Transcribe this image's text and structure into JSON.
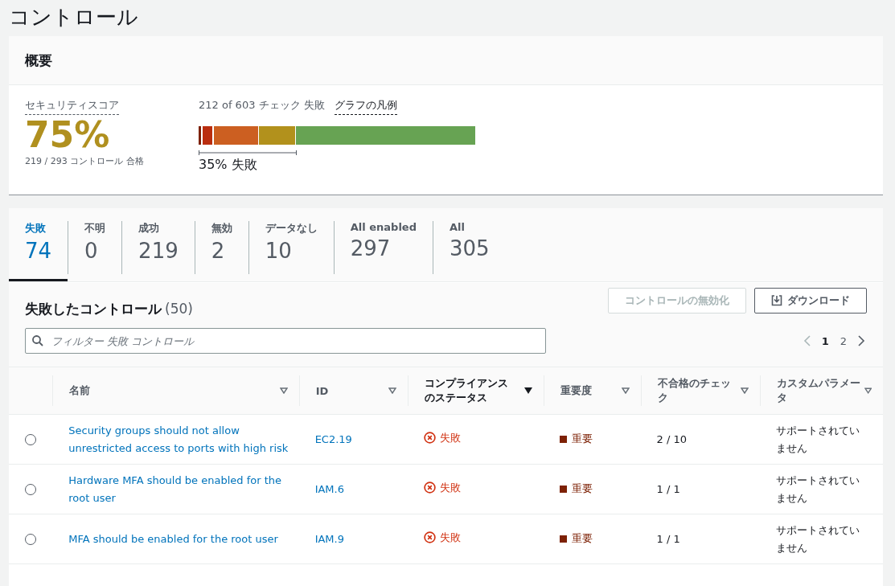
{
  "page_title": "コントロール",
  "overview": {
    "title": "概要",
    "score_label": "セキュリティスコア",
    "score": "75%",
    "score_detail": "219 / 293 コントロール 合格",
    "checks_summary": "212 of 603 チェック 失敗",
    "legend_link": "グラフの凡例",
    "failed_share": "35% 失敗"
  },
  "tabs": [
    {
      "label": "失敗",
      "count": "74",
      "selected": true
    },
    {
      "label": "不明",
      "count": "0",
      "selected": false
    },
    {
      "label": "成功",
      "count": "219",
      "selected": false
    },
    {
      "label": "無効",
      "count": "2",
      "selected": false
    },
    {
      "label": "データなし",
      "count": "10",
      "selected": false
    },
    {
      "label": "All enabled",
      "count": "297",
      "selected": false
    },
    {
      "label": "All",
      "count": "305",
      "selected": false
    }
  ],
  "table_panel": {
    "title": "失敗したコントロール",
    "count": "(50)",
    "buttons": [
      {
        "label": "コントロールの無効化",
        "kind": "plain",
        "disabled": true
      },
      {
        "label": "ダウンロード",
        "kind": "download",
        "disabled": false
      }
    ],
    "filter": {
      "placeholder": "フィルター 失敗 コントロール"
    },
    "pagination": [
      {
        "label": "1",
        "selected": true
      },
      {
        "label": "2",
        "selected": false
      }
    ]
  },
  "table": {
    "columns": [
      {
        "label": "名前",
        "sorted": false
      },
      {
        "label": "ID",
        "sorted": false
      },
      {
        "label": "コンプライアンスのステータス",
        "sorted": true
      },
      {
        "label": "重要度",
        "sorted": false
      },
      {
        "label": "不合格のチェック",
        "sorted": false
      },
      {
        "label": "カスタムパラメータ",
        "sorted": false
      }
    ],
    "rows": [
      {
        "selected": false,
        "name": "Security groups should not allow unrestricted access to ports with high risk",
        "id": "EC2.19",
        "status": {
          "kind": "failed",
          "label": "失敗"
        },
        "severity": {
          "kind": "critical",
          "label": "重要"
        },
        "failed_checks": "2 / 10",
        "custom_parameters": "サポートされていません"
      },
      {
        "selected": false,
        "name": "Hardware MFA should be enabled for the root user",
        "id": "IAM.6",
        "status": {
          "kind": "failed",
          "label": "失敗"
        },
        "severity": {
          "kind": "critical",
          "label": "重要"
        },
        "failed_checks": "1 / 1",
        "custom_parameters": "サポートされていません"
      },
      {
        "selected": false,
        "name": "MFA should be enabled for the root user",
        "id": "IAM.9",
        "status": {
          "kind": "failed",
          "label": "失敗"
        },
        "severity": {
          "kind": "critical",
          "label": "重要"
        },
        "failed_checks": "1 / 1",
        "custom_parameters": "サポートされていません"
      }
    ]
  }
}
